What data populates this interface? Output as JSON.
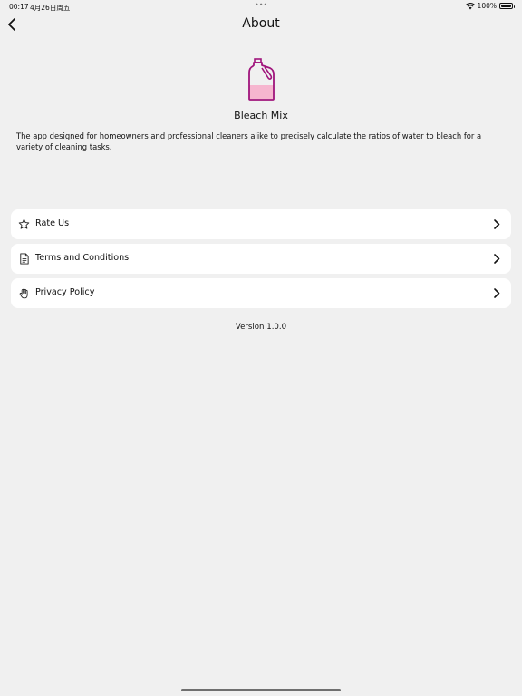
{
  "status_bar": {
    "time": "00:17",
    "date": "4月26日周五",
    "battery": "100%"
  },
  "nav": {
    "title": "About",
    "back_icon": "chevron-left-icon"
  },
  "app": {
    "name": "Bleach Mix",
    "icon": "bleach-bottle-icon",
    "description": "The app designed for homeowners and professional cleaners alike to precisely calculate the ratios of water to bleach for a variety of cleaning tasks."
  },
  "menu": {
    "items": [
      {
        "label": "Rate Us",
        "icon": "star-icon"
      },
      {
        "label": "Terms and Conditions",
        "icon": "document-icon"
      },
      {
        "label": "Privacy Policy",
        "icon": "hand-icon"
      }
    ]
  },
  "version": "Version 1.0.0",
  "colors": {
    "background": "#f0f0f0",
    "card": "#ffffff",
    "bottle_outline": "#a0147c",
    "bottle_fill": "#f6b6cf"
  }
}
